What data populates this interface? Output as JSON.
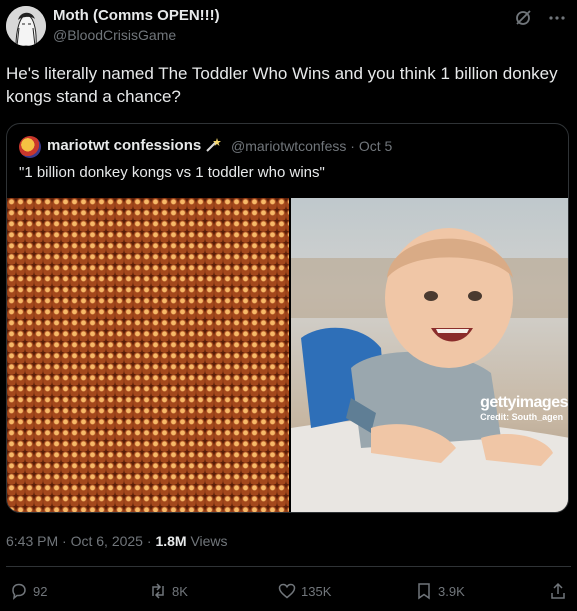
{
  "author": {
    "display_name": "Moth (Comms OPEN!!!)",
    "handle": "@BloodCrisisGame",
    "avatar_icon": "sketch-avatar-icon"
  },
  "tweet": {
    "text": "He's literally named The Toddler Who Wins and you think 1 billion donkey kongs stand a chance?",
    "time": "6:43 PM",
    "date": "Oct 6, 2025",
    "views_count": "1.8M",
    "views_label": "Views"
  },
  "quote": {
    "display_name": "mariotwt confessions",
    "handle": "@mariotwtconfess",
    "date": "Oct 5",
    "text": "\"1 billion donkey kongs vs 1 toddler who wins\"",
    "emoji_icon": "magic-wand-icon",
    "images": [
      {
        "description_icon": "crowd-of-donkey-kongs-image"
      },
      {
        "description_icon": "smiling-baby-photo",
        "watermark": "gettyimages",
        "credit": "Credit: South_agen"
      }
    ]
  },
  "actions": {
    "replies": "92",
    "reposts": "8K",
    "likes": "135K",
    "bookmarks": "3.9K"
  },
  "colors": {
    "background": "#000000",
    "text_primary": "#e7e9ea",
    "text_secondary": "#71767b",
    "border": "#2f3336"
  }
}
